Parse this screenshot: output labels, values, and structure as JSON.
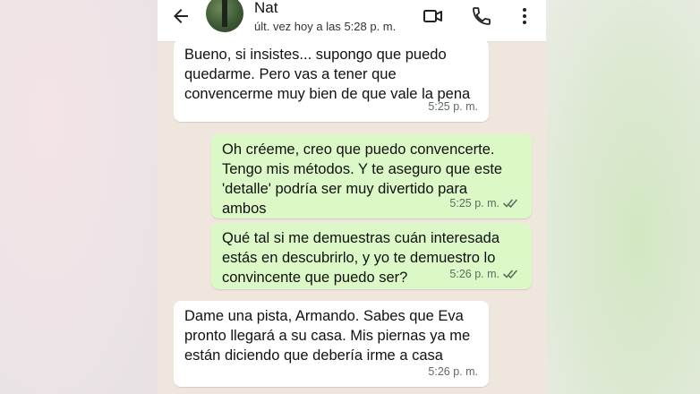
{
  "contact": {
    "name": "Nat",
    "status": "últ. vez hoy a las 5:28 p. m."
  },
  "icons": {
    "back": "arrow-back-icon",
    "video": "video-call-icon",
    "call": "phone-icon",
    "more": "more-vert-icon"
  },
  "colors": {
    "incoming_bubble": "#ffffff",
    "outgoing_bubble": "#dbf8c6",
    "chat_background": "#efe7de",
    "read_ticks": "#5f6b61"
  },
  "messages": [
    {
      "direction": "in",
      "text": "Bueno, si insistes... supongo que puedo\nquedarme. Pero vas a tener que\nconvencerme muy bien de que vale la pena",
      "time": "5:25 p. m."
    },
    {
      "direction": "out",
      "text": "Oh créeme, creo que puedo convencerte.\nTengo mis métodos. Y te aseguro que este\n'detalle' podría ser muy divertido para\nambos",
      "time": "5:25 p. m.",
      "status": "read"
    },
    {
      "direction": "out",
      "text": "Qué tal si me demuestras cuán interesada\nestás en descubrirlo, y yo te demuestro lo\nconvincente que puedo ser?",
      "time": "5:26 p. m.",
      "status": "read"
    },
    {
      "direction": "in",
      "text": "Dame una pista, Armando. Sabes que Eva\npronto llegará a su casa. Mis piernas ya me\nestán diciendo que debería irme a casa",
      "time": "5:26 p. m."
    }
  ]
}
